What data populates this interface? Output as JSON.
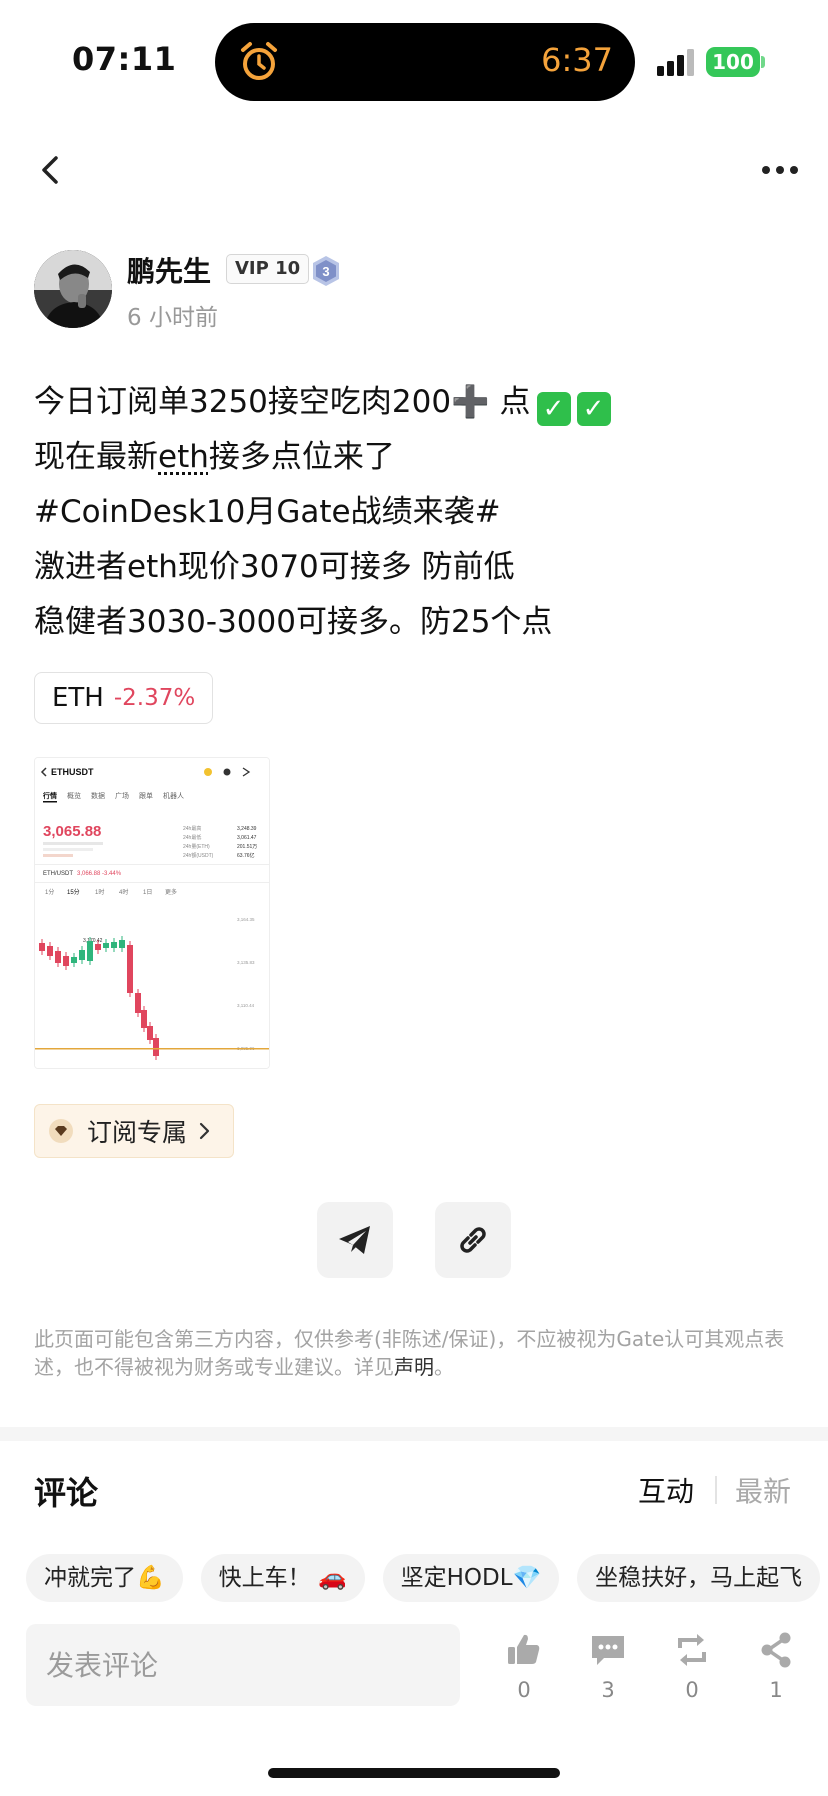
{
  "status_bar": {
    "time": "07:11",
    "timer": "6:37",
    "battery": "100",
    "alarm_icon": "alarm-clock-icon",
    "signal_icon": "signal-icon"
  },
  "nav": {
    "back_icon": "chevron-left-icon",
    "more_icon": "more-dots-icon"
  },
  "author": {
    "name": "鹏先生",
    "vip": "VIP 10",
    "level": "3",
    "time_ago": "6 小时前"
  },
  "post": {
    "line1": "今日订阅单3250接空吃肉200➕ 点",
    "line1_checks": [
      "✓",
      "✓"
    ],
    "line2_prefix": "现在最新",
    "line2_link": "eth",
    "line2_suffix": "接多点位来了",
    "line3": "#CoinDesk10月Gate战绩来袭#",
    "line4": "激进者eth现价3070可接多 防前低",
    "line5": "稳健者3030-3000可接多。防25个点"
  },
  "ticker": {
    "name": "ETH",
    "change": "-2.37%"
  },
  "thumbnail": {
    "pair": "ETHUSDT",
    "tabs": [
      "行情",
      "概览",
      "数据",
      "广场",
      "跟单",
      "机器人"
    ],
    "price": "3,065.88",
    "sub_pair": "ETH/USDT",
    "sub_price": "3,066.88 -3.44%",
    "intervals": [
      "1分",
      "15分",
      "1时",
      "4时",
      "1日",
      "更多"
    ],
    "stats_labels": [
      "24h最高",
      "24h最低",
      "24h量(ETH)",
      "24h额(USDT)"
    ],
    "stats_values": [
      "3,248.39",
      "3,061.47",
      "201.51万",
      "63.76亿"
    ],
    "peak_label": "3,170.42",
    "axis_labels": [
      "3,164.35",
      "3,135.83",
      "3,110.44",
      "3,085.06"
    ]
  },
  "subscribe": {
    "label": "订阅专属",
    "icon": "diamond-icon"
  },
  "share": {
    "telegram_icon": "telegram-icon",
    "link_icon": "link-icon"
  },
  "disclaimer": {
    "text": "此页面可能包含第三方内容，仅供参考(非陈述/保证)，不应被视为Gate认可其观点表述，也不得被视为财务或专业建议。详见",
    "link": "声明",
    "end": "。"
  },
  "comments": {
    "title": "评论",
    "sort_hot": "互动",
    "sort_new": "最新",
    "chips": [
      "冲就完了💪",
      "快上车！ 🚗",
      "坚定HODL💎",
      "坐稳扶好，马上起飞"
    ],
    "input_placeholder": "发表评论"
  },
  "actions": {
    "like_count": "0",
    "comment_count": "3",
    "repost_count": "0",
    "share_count": "1"
  },
  "colors": {
    "accent_green": "#35c759",
    "negative_red": "#e0465e",
    "timer_orange": "#f5a33b",
    "subscribe_bg": "#fdf4e8"
  }
}
